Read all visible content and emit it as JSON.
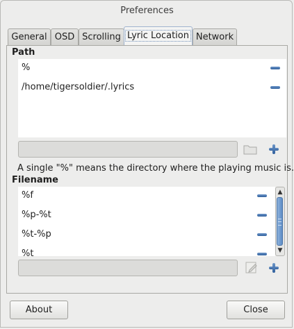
{
  "window": {
    "title": "Preferences"
  },
  "tabs": [
    {
      "label": "General"
    },
    {
      "label": "OSD"
    },
    {
      "label": "Scrolling"
    },
    {
      "label": "Lyric Location",
      "active": true
    },
    {
      "label": "Network"
    }
  ],
  "path_section": {
    "label": "Path",
    "items": [
      "%",
      "/home/tigersoldier/.lyrics"
    ],
    "entry_value": "",
    "note": "A single \"%\" means the directory where the playing music is."
  },
  "filename_section": {
    "label": "Filename",
    "items": [
      "%f",
      "%p-%t",
      "%t-%p",
      "%t"
    ],
    "entry_value": ""
  },
  "footer": {
    "about_label": "About",
    "close_label": "Close"
  },
  "icons": {
    "remove": "minus-icon",
    "add": "plus-icon",
    "browse": "folder-icon",
    "edit": "pencil-icon",
    "scroll_up": "arrow-up-icon",
    "scroll_down": "arrow-down-icon"
  },
  "colors": {
    "accent": "#3f6fae",
    "active_tab_border": "#9fb3cf"
  }
}
